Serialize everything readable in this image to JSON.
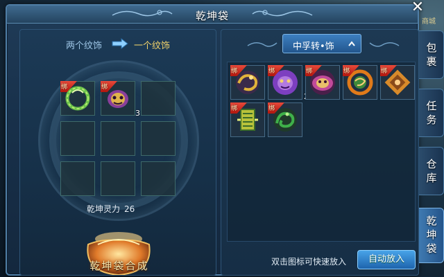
{
  "window": {
    "title": "乾坤袋",
    "close_glyph": "✕"
  },
  "side_tabs": [
    {
      "label": "包\n裹",
      "active": false
    },
    {
      "label": "任\n务",
      "active": false
    },
    {
      "label": "仓\n库",
      "active": false
    },
    {
      "label": "乾\n坤\n袋",
      "active": true
    }
  ],
  "shop_label": "商城",
  "synthesis": {
    "from_label": "两个纹饰",
    "to_label": "一个纹饰",
    "slots": [
      {
        "item": "green-dragon-ring",
        "count": ""
      },
      {
        "item": "purple-beast-mask",
        "count": "3"
      },
      {
        "item": "",
        "count": ""
      },
      {
        "item": "",
        "count": ""
      },
      {
        "item": "",
        "count": ""
      },
      {
        "item": "",
        "count": ""
      },
      {
        "item": "",
        "count": ""
      },
      {
        "item": "",
        "count": ""
      },
      {
        "item": "",
        "count": ""
      }
    ],
    "power_label": "乾坤灵力",
    "power_value": "26",
    "bag_button_label": "乾坤袋合成"
  },
  "inventory": {
    "filter_label": "中孚转•饰",
    "bind_label": "绑",
    "items": [
      {
        "name": "golden-dragon-coil",
        "count": "",
        "color": "#c9a23a",
        "inner": "#6a3d8a"
      },
      {
        "name": "purple-lion-mask",
        "count": "2",
        "color": "#7d3fc0",
        "inner": "#d9b04a"
      },
      {
        "name": "violet-beast-face",
        "count": "",
        "color": "#c14a9a",
        "inner": "#e8c06a"
      },
      {
        "name": "orange-phoenix-ring",
        "count": "",
        "color": "#e07a1a",
        "inner": "#3f8a3a"
      },
      {
        "name": "bronze-knot-ornament",
        "count": "",
        "color": "#d88a2a",
        "inner": "#8a4a1a"
      },
      {
        "name": "yellow-green-tablet",
        "count": "",
        "color": "#b8c23a",
        "inner": "#3a6a2a"
      },
      {
        "name": "jade-dragon-charm",
        "count": "",
        "color": "#3fb04a",
        "inner": "#1f5a2a"
      }
    ],
    "hint": "双击图标可快速放入",
    "auto_place_label": "自动放入"
  }
}
